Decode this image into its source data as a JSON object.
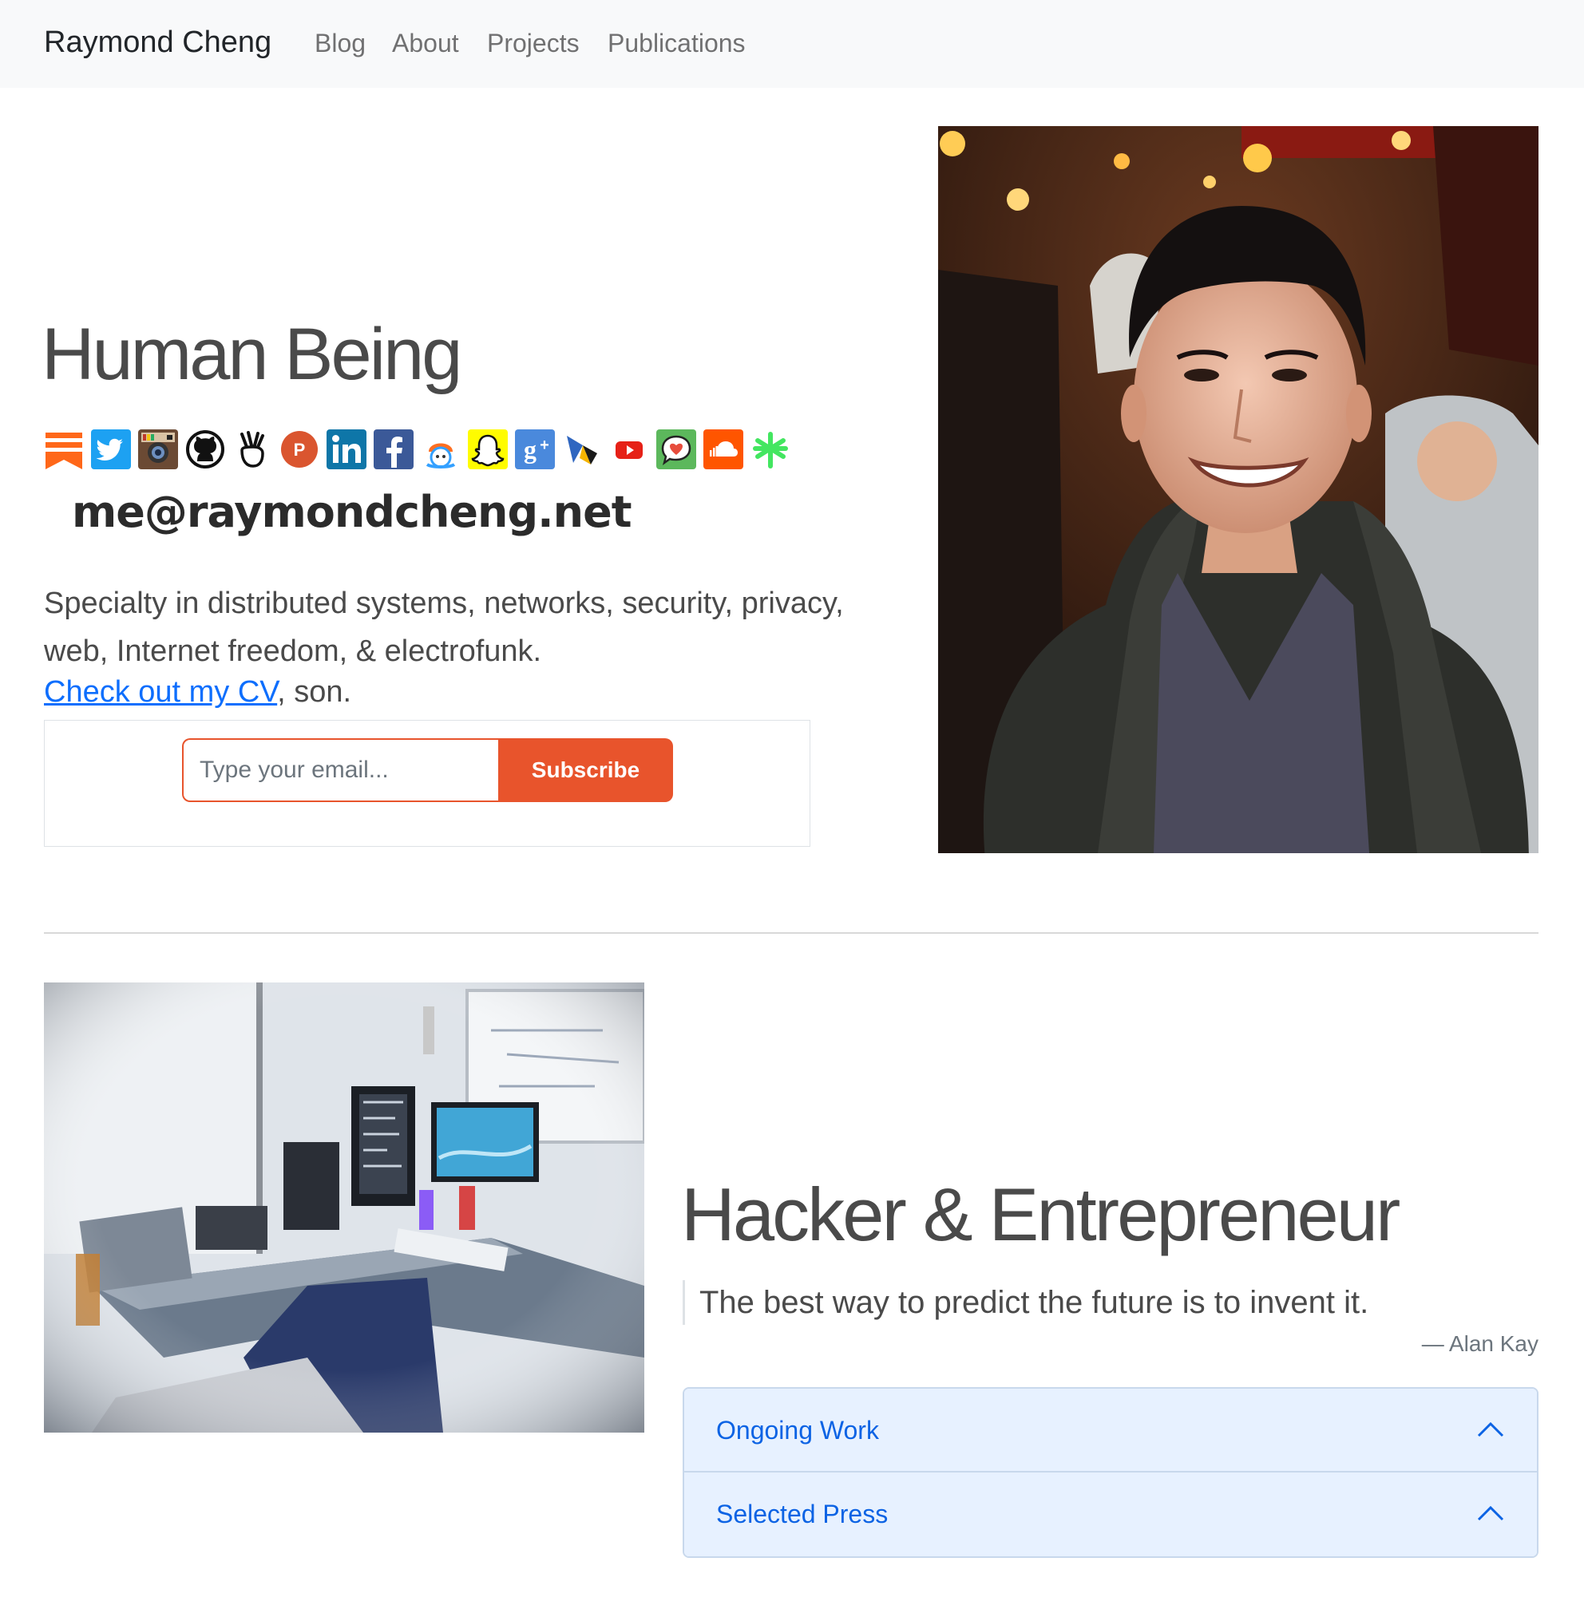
{
  "nav": {
    "brand": "Raymond Cheng",
    "links": [
      "Blog",
      "About",
      "Projects",
      "Publications"
    ]
  },
  "hero": {
    "title": "Human Being",
    "social_icons": [
      "substack-icon",
      "twitter-icon",
      "instagram-icon",
      "github-icon",
      "angellist-icon",
      "producthunt-icon",
      "linkedin-icon",
      "facebook-icon",
      "keybase-icon",
      "snapchat-icon",
      "google-plus-icon",
      "medium-icon",
      "youtube-icon",
      "chat-heart-icon",
      "soundcloud-icon",
      "linktree-icon"
    ],
    "email": "me@raymondcheng.net",
    "specialty": "Specialty in distributed systems, networks, security, privacy, web, Internet freedom, & electrofunk.",
    "cv_link": " Check out my CV",
    "cv_suffix": ", son.",
    "subscribe": {
      "placeholder": "Type your email...",
      "button": "Subscribe"
    }
  },
  "section2": {
    "title": "Hacker & Entrepreneur",
    "quote": "The best way to predict the future is to invent it.",
    "quote_source": "— Alan Kay",
    "accordion": [
      "Ongoing Work",
      "Selected Press"
    ]
  },
  "colors": {
    "accent": "#e8542c",
    "link": "#0d6efd",
    "accordion_bg": "#e7f1ff"
  }
}
